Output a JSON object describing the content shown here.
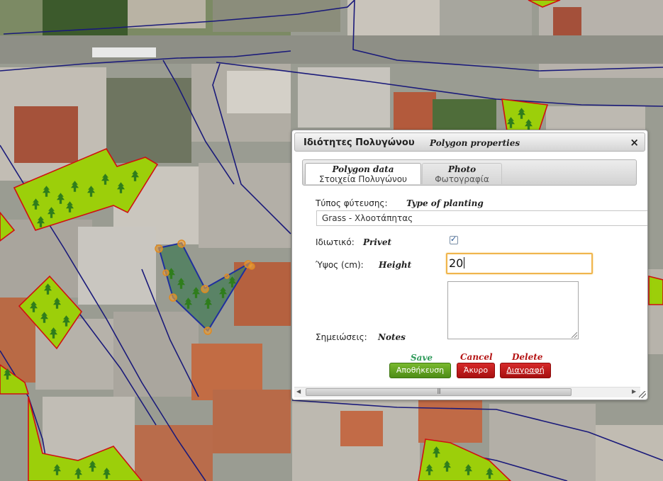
{
  "dialog": {
    "title_gr": "Ιδιότητες Πολυγώνου",
    "title_en": "Polygon properties",
    "close_glyph": "×"
  },
  "tabs": [
    {
      "en": "Polygon data",
      "gr": "Στοιχεία Πολυγώνου",
      "active": true
    },
    {
      "en": "Photo",
      "gr": "Φωτογραφία",
      "active": false
    }
  ],
  "form": {
    "planting_label_gr": "Τύπος φύτευσης:",
    "planting_label_en": "Type of planting",
    "planting_value": "Grass - Χλοοτάπητας",
    "private_label_gr": "Ιδιωτικό:",
    "private_label_en": "Privet",
    "private_checked": true,
    "height_label_gr": "Ύψος (cm):",
    "height_label_en": "Height",
    "height_value": "20",
    "notes_label_gr": "Σημειώσεις:",
    "notes_label_en": "Notes",
    "notes_value": ""
  },
  "buttons": {
    "save_en": "Save",
    "save_gr": "Αποθήκευση",
    "cancel_en": "Cancel",
    "cancel_gr": "Άκυρο",
    "delete_en": "Delete",
    "delete_gr": "Διαγραφή"
  },
  "colors": {
    "save_green": "#5a9a1e",
    "save_caption": "#2e9a5a",
    "danger_red": "#b51515",
    "focus_orange": "#f0b54c",
    "parcel_line": "#1a1a7a",
    "planting_fill": "#9ccf0a",
    "planting_border": "#d01010",
    "tree_green": "#2f7d1c",
    "selected_fill": "#4f7f5e",
    "vertex_orange": "#e8a03c"
  },
  "icons": {
    "close": "close-icon",
    "checkbox": "checkbox-checked-icon",
    "scroll_left": "arrow-left-icon",
    "scroll_right": "arrow-right-icon",
    "resize": "resize-grip-icon",
    "tree": "tree-icon"
  }
}
